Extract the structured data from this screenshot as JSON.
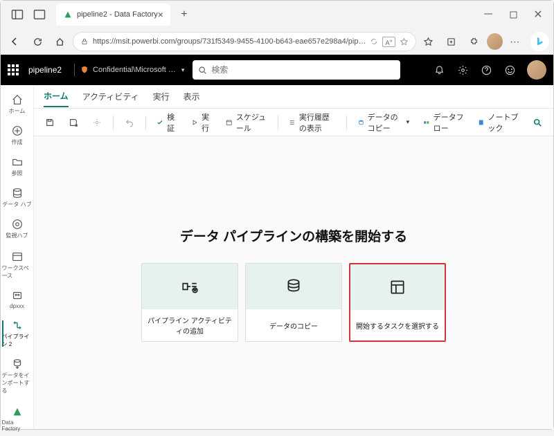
{
  "browser": {
    "tab_title": "pipeline2 - Data Factory",
    "url": "https://msit.powerbi.com/groups/731f5349-9455-4100-b643-eae657e298a4/pip…"
  },
  "appbar": {
    "pipeline": "pipeline2",
    "sensitivity": "Confidential\\Microsoft …",
    "search_placeholder": "検索"
  },
  "leftnav": {
    "home": "ホーム",
    "create": "作成",
    "browse": "参照",
    "datahub": "データ ハブ",
    "monitor": "監視ハブ",
    "workspace": "ワークスペース",
    "dpxxx": "dpxxx",
    "pipeline2": "パイプライン 2",
    "import": "データをインポートする",
    "datafactory": "Data Factory"
  },
  "ribbon": {
    "home": "ホーム",
    "activity": "アクティビティ",
    "run": "実行",
    "view": "表示"
  },
  "toolbar": {
    "validate": "検証",
    "run": "実行",
    "schedule": "スケジュール",
    "history": "実行履歴の表示",
    "copydata": "データのコピー",
    "dataflow": "データフロー",
    "notebook": "ノートブック"
  },
  "canvas": {
    "title": "データ パイプラインの構築を開始する",
    "cards": {
      "add_activity": "パイプライン アクティビティの追加",
      "copy_data": "データのコピー",
      "choose_task": "開始するタスクを選択する"
    }
  }
}
